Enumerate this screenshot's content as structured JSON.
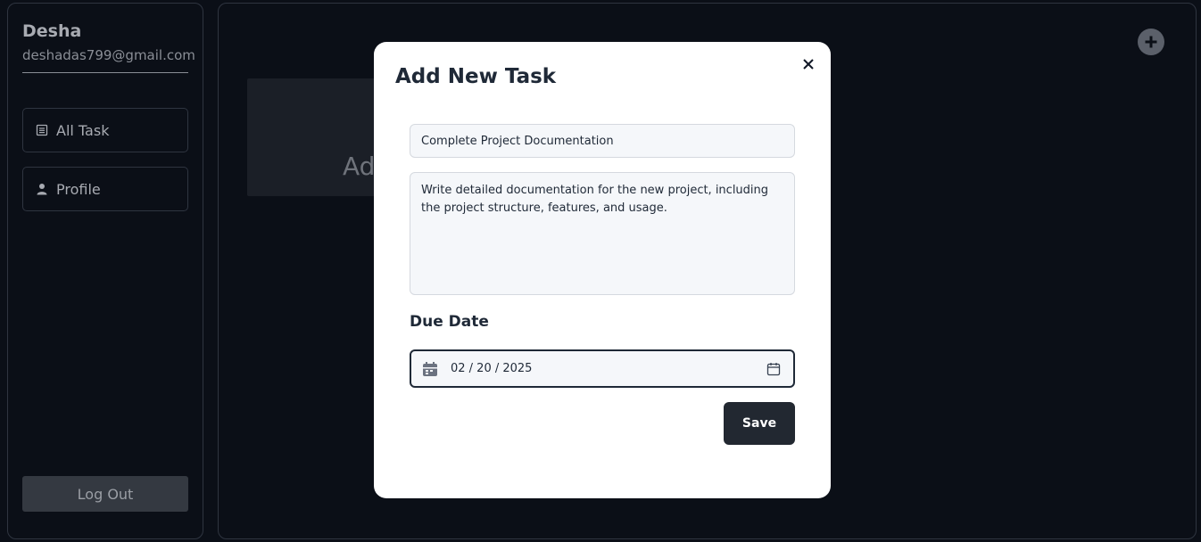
{
  "sidebar": {
    "user_name": "Desha",
    "user_email": "deshadas799@gmail.com",
    "items": [
      {
        "label": "All Task",
        "icon": "list-icon"
      },
      {
        "label": "Profile",
        "icon": "user-icon"
      }
    ],
    "logout_label": "Log Out"
  },
  "main": {
    "add_button_icon": "plus-circle-icon",
    "add_card_text": "Ad"
  },
  "modal": {
    "title": "Add New Task",
    "close_icon": "close-icon",
    "task_title_value": "Complete Project Documentation",
    "description_value": "Write detailed documentation for the new project, including the project structure, features, and usage.",
    "due_date_label": "Due Date",
    "due_date_value": "02 / 20 / 2025",
    "save_label": "Save"
  },
  "colors": {
    "background": "#0b0f17",
    "modal_bg": "#ffffff",
    "primary_button": "#222831",
    "border": "#2f3540"
  }
}
